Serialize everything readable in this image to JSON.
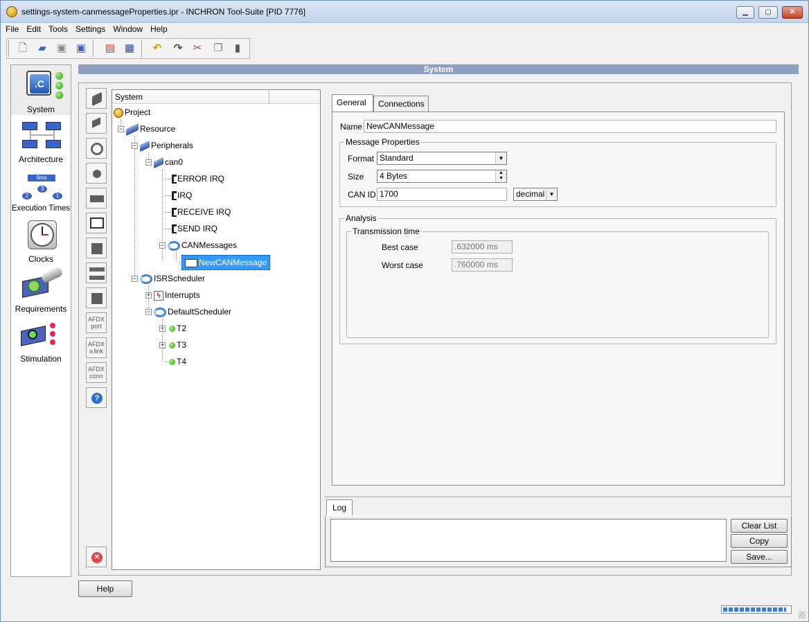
{
  "window": {
    "title": "settings-system-canmessageProperties.ipr - INCHRON Tool-Suite [PID 7776]"
  },
  "menu": [
    "File",
    "Edit",
    "Tools",
    "Settings",
    "Window",
    "Help"
  ],
  "toolbar_icons": [
    "new-file-icon",
    "open-folder-icon",
    "save-icon",
    "save-as-icon",
    "report-icon",
    "chart-icon",
    "undo-icon",
    "redo-icon",
    "cut-icon",
    "copy-icon",
    "paste-icon"
  ],
  "nav": [
    {
      "label": "System",
      "icon": "system-icon"
    },
    {
      "label": "Architecture",
      "icon": "architecture-icon"
    },
    {
      "label": "Execution Times",
      "icon": "execution-times-icon"
    },
    {
      "label": "Clocks",
      "icon": "clock-icon"
    },
    {
      "label": "Requirements",
      "icon": "requirements-icon"
    },
    {
      "label": "Stimulation",
      "icon": "stimulation-icon"
    }
  ],
  "nav_badge": ".C",
  "exec_badge": "6ms",
  "exec_nodes": [
    "2",
    "3",
    "1"
  ],
  "system_bar": "System",
  "side_icons": {
    "afdx_port": [
      "AFDX",
      "port"
    ],
    "afdx_vlink": [
      "AFDX",
      "v.link"
    ],
    "afdx_conn": [
      "AFDX",
      "conn"
    ],
    "help": "?"
  },
  "tree": {
    "header": "System",
    "nodes": [
      {
        "label": "Project"
      },
      {
        "label": "Resource"
      },
      {
        "label": "Peripherals"
      },
      {
        "label": "can0"
      },
      {
        "label": "ERROR IRQ"
      },
      {
        "label": "IRQ"
      },
      {
        "label": "RECEIVE IRQ"
      },
      {
        "label": "SEND IRQ"
      },
      {
        "label": "CANMessages"
      },
      {
        "label": "NewCANMessage"
      },
      {
        "label": "ISRScheduler"
      },
      {
        "label": "Interrupts"
      },
      {
        "label": "DefaultScheduler"
      },
      {
        "label": "T2"
      },
      {
        "label": "T3"
      },
      {
        "label": "T4"
      }
    ]
  },
  "tabs": [
    "General",
    "Connections"
  ],
  "general": {
    "name_label": "Name",
    "name_value": "NewCANMessage",
    "message_properties": "Message Properties",
    "format_label": "Format",
    "format_value": "Standard",
    "size_label": "Size",
    "size_value": "4 Bytes",
    "canid_label": "CAN ID",
    "canid_value": "1700",
    "canid_base": "decimal",
    "analysis": "Analysis",
    "transmission_time": "Transmission time",
    "best_label": "Best case",
    "best_value": ".632000 ms",
    "worst_label": "Worst case",
    "worst_value": ".760000 ms"
  },
  "log": {
    "tab": "Log",
    "clear": "Clear List",
    "copy": "Copy",
    "save": "Save..."
  },
  "help_button": "Help",
  "progress": 0.95
}
